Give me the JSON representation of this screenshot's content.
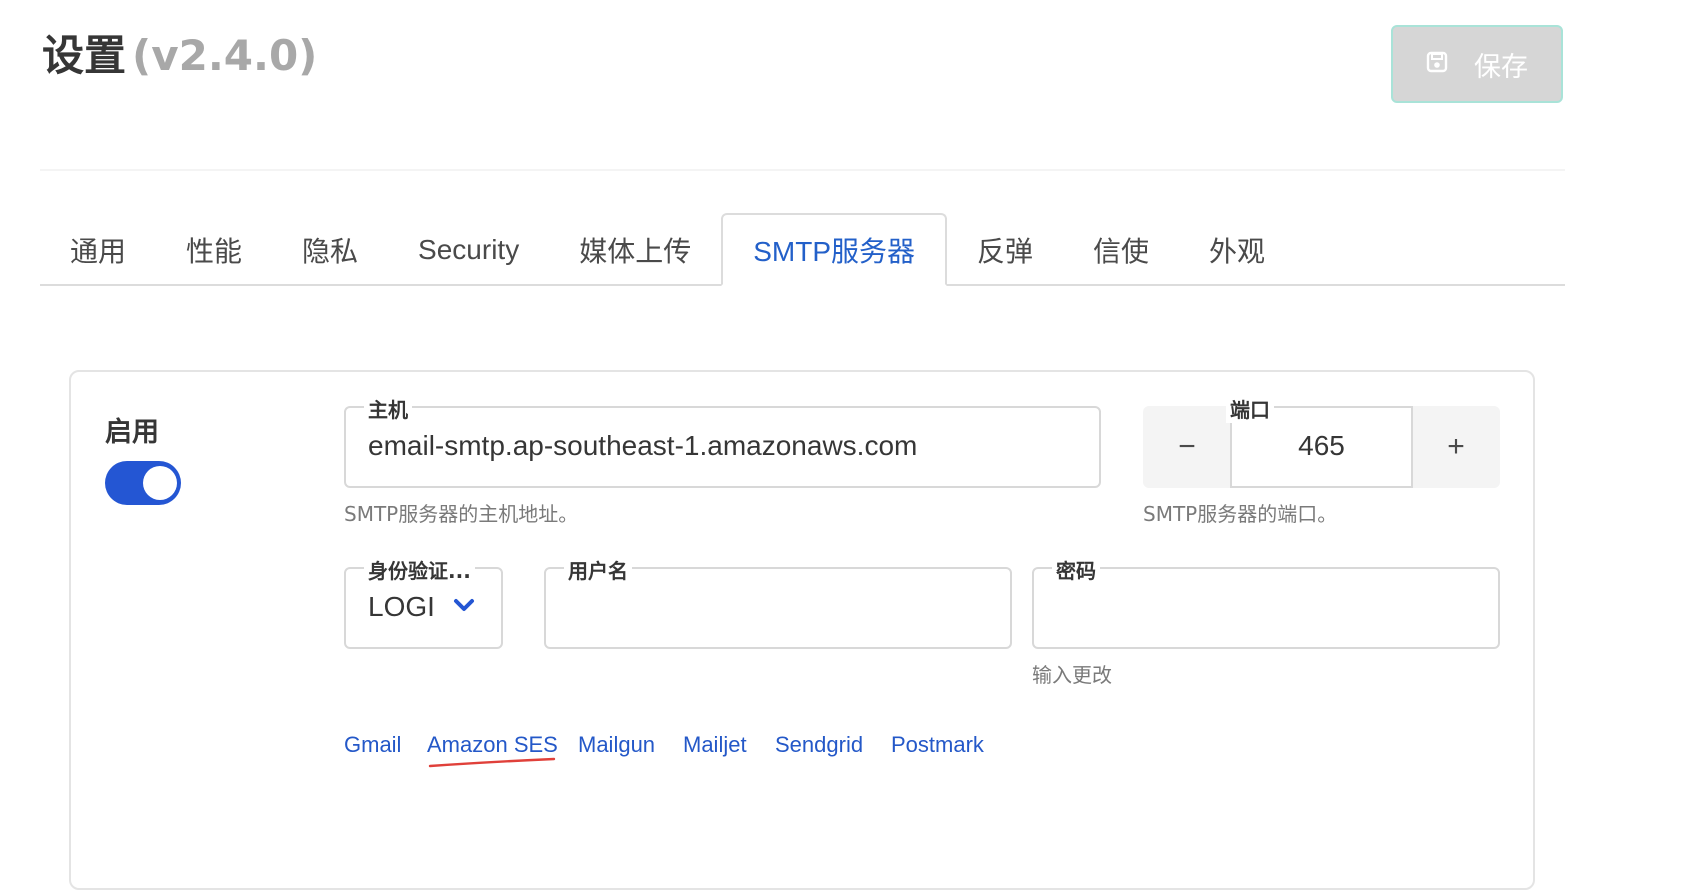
{
  "header": {
    "title": "设置",
    "version": "(v2.4.0)",
    "save_label": "保存",
    "save_icon": "floppy-disk-icon"
  },
  "tabs": [
    {
      "label": "通用",
      "active": false
    },
    {
      "label": "性能",
      "active": false
    },
    {
      "label": "隐私",
      "active": false
    },
    {
      "label": "Security",
      "active": false
    },
    {
      "label": "媒体上传",
      "active": false
    },
    {
      "label": "SMTP服务器",
      "active": true
    },
    {
      "label": "反弹",
      "active": false
    },
    {
      "label": "信使",
      "active": false
    },
    {
      "label": "外观",
      "active": false
    }
  ],
  "smtp": {
    "enable_label": "启用",
    "enabled": true,
    "host": {
      "label": "主机",
      "value": "email-smtp.ap-southeast-1.amazonaws.com",
      "help": "SMTP服务器的主机地址。"
    },
    "port": {
      "label": "端口",
      "value": "465",
      "decrement": "−",
      "increment": "+",
      "help": "SMTP服务器的端口。"
    },
    "auth": {
      "label": "身份验证...",
      "value": "LOGI"
    },
    "username": {
      "label": "用户名",
      "value": ""
    },
    "password": {
      "label": "密码",
      "value": "",
      "help": "输入更改"
    },
    "providers": [
      "Gmail",
      "Amazon SES",
      "Mailgun",
      "Mailjet",
      "Sendgrid",
      "Postmark"
    ]
  },
  "colors": {
    "accent": "#2456d3",
    "link": "#2458c8",
    "annotation_underline": "#e0403a"
  }
}
